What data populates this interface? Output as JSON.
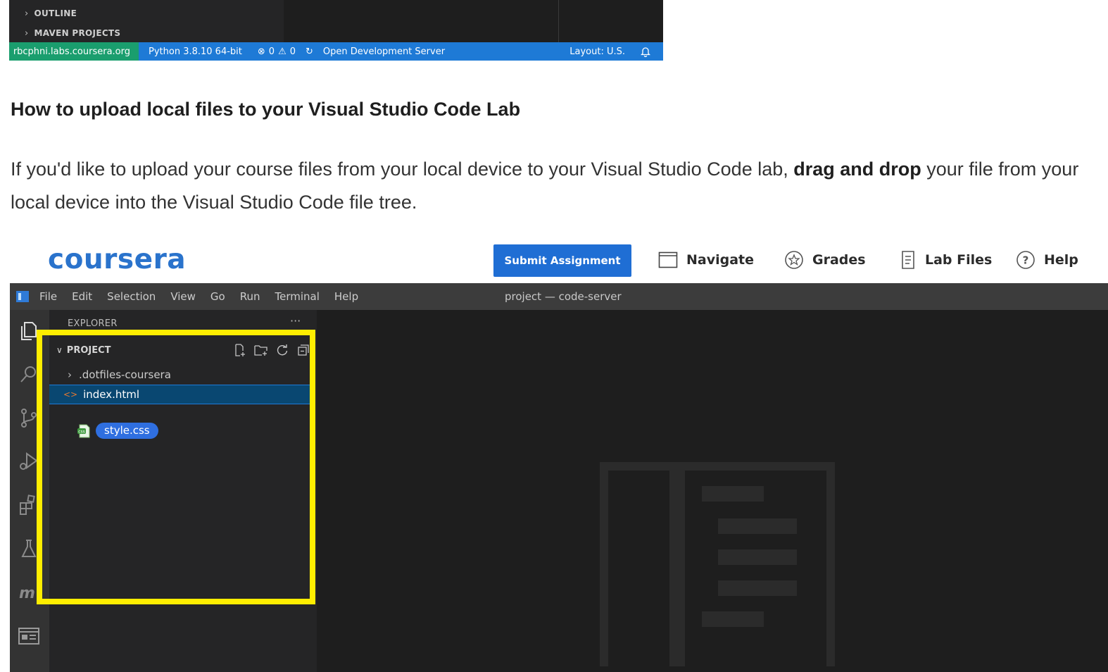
{
  "top_shot": {
    "sections": [
      "OUTLINE",
      "MAVEN PROJECTS"
    ],
    "status_bar": {
      "remote": "rbcphni.labs.coursera.org",
      "python": "Python 3.8.10 64-bit",
      "errors": "0",
      "warnings": "0",
      "dev_server": "Open Development Server",
      "layout": "Layout: U.S."
    }
  },
  "article": {
    "heading": "How to upload local files to your Visual Studio Code Lab",
    "para_before": "If you'd like to upload your course files from your local device to your Visual Studio Code lab, ",
    "para_bold": "drag and drop",
    "para_after": " your file from your local device into the Visual Studio Code file tree."
  },
  "coursera_bar": {
    "logo": "coursera",
    "submit": "Submit Assignment",
    "nav": [
      "Navigate",
      "Grades",
      "Lab Files",
      "Help"
    ]
  },
  "vscode": {
    "menu": [
      "File",
      "Edit",
      "Selection",
      "View",
      "Go",
      "Run",
      "Terminal",
      "Help"
    ],
    "window_title": "project — code-server",
    "explorer_label": "EXPLORER",
    "ellipsis": "···",
    "project_label": "PROJECT",
    "tree": [
      ".dotfiles-coursera",
      "index.html"
    ],
    "dragged_file": "style.css"
  },
  "colors": {
    "status_bar": "#1e7ad6",
    "remote": "#1a9e6e",
    "submit_button": "#1f6ed4",
    "highlight": "#ffee00",
    "logo": "#2a73cc"
  }
}
